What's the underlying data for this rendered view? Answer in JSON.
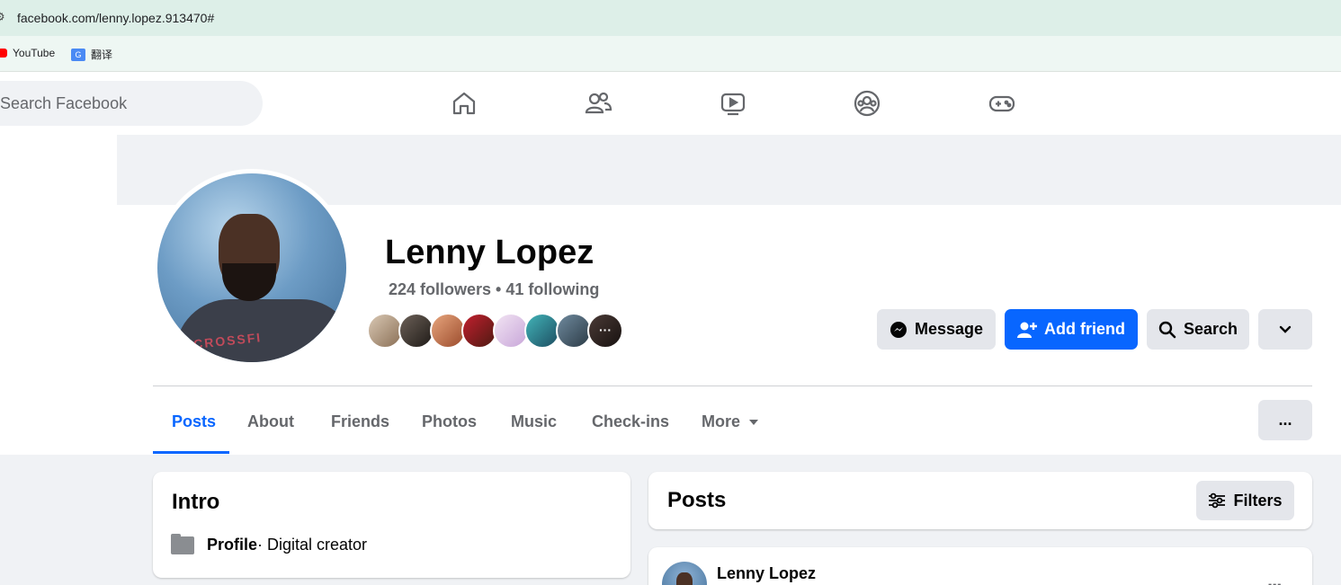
{
  "browser": {
    "url": "facebook.com/lenny.lopez.913470#",
    "bookmarks": [
      {
        "label": "YouTube",
        "icon": "youtube-icon"
      },
      {
        "label": "翻译",
        "icon": "translate-icon"
      }
    ]
  },
  "nav": {
    "search_placeholder": "Search Facebook",
    "icons": [
      "home-icon",
      "friends-icon",
      "watch-icon",
      "groups-icon",
      "gaming-icon"
    ]
  },
  "profile": {
    "name": "Lenny Lopez",
    "stats": "224 followers • 41 following",
    "mutual_friend_avatar_count": 8
  },
  "actions": {
    "message": "Message",
    "add_friend": "Add friend",
    "search": "Search",
    "dropdown": "chevron-down-icon"
  },
  "tabs": [
    {
      "label": "Posts",
      "active": true
    },
    {
      "label": "About",
      "active": false
    },
    {
      "label": "Friends",
      "active": false
    },
    {
      "label": "Photos",
      "active": false
    },
    {
      "label": "Music",
      "active": false
    },
    {
      "label": "Check-ins",
      "active": false
    },
    {
      "label": "More",
      "active": false
    }
  ],
  "more_menu_label": "...",
  "intro": {
    "title": "Intro",
    "profile_label": "Profile",
    "profile_value": " · Digital creator"
  },
  "posts": {
    "title": "Posts",
    "filters_label": "Filters",
    "first_post_author": "Lenny Lopez",
    "first_post_menu": "..."
  },
  "colors": {
    "accent": "#0866ff",
    "background": "#f0f2f5",
    "secondary_text": "#65676b",
    "button_grey": "#e4e6eb"
  }
}
